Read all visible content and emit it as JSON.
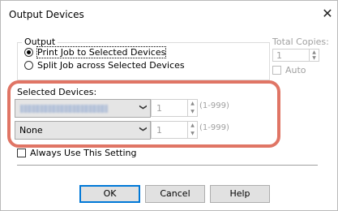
{
  "window": {
    "title": "Output Devices",
    "close_glyph": "✕"
  },
  "output": {
    "group_label": "Output",
    "options": [
      {
        "label": "Print Job to Selected Devices",
        "checked": true
      },
      {
        "label": "Split Job across Selected Devices",
        "checked": false
      }
    ]
  },
  "total_copies": {
    "label": "Total Copies:",
    "value": "1",
    "auto_label": "Auto",
    "auto_checked": false,
    "enabled": false
  },
  "selected_devices": {
    "label": "Selected Devices:",
    "rows": [
      {
        "device": "",
        "device_obscured": true,
        "copies": "1",
        "range": "(1-999)"
      },
      {
        "device": "None",
        "device_obscured": false,
        "copies": "1",
        "range": "(1-999)"
      }
    ]
  },
  "always_use": {
    "label": "Always Use This Setting",
    "checked": false
  },
  "buttons": {
    "ok": "OK",
    "cancel": "Cancel",
    "help": "Help"
  },
  "colors": {
    "highlight": "#e07565",
    "default_button_border": "#0078d7",
    "combo_bg": "#e5e5e5"
  }
}
